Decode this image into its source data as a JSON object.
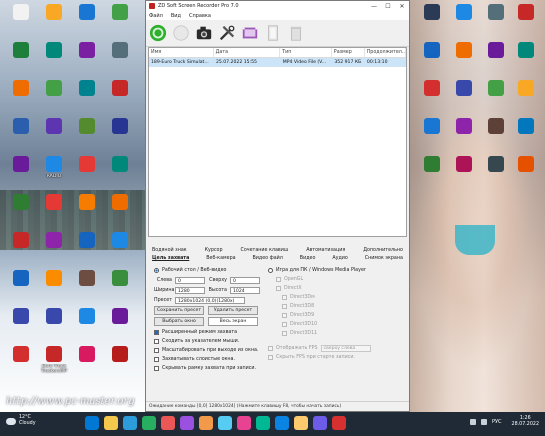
{
  "desktop": {
    "icons": [
      {
        "label": "",
        "color": "#f2f2f2"
      },
      {
        "label": "",
        "color": "#1e7f3c"
      },
      {
        "label": "",
        "color": "#ef6c00"
      },
      {
        "label": "",
        "color": "#2b5fae"
      },
      {
        "label": "",
        "color": "#6a1b9a"
      },
      {
        "label": "",
        "color": "#2e7d32"
      },
      {
        "label": "",
        "color": "#c62828"
      },
      {
        "label": "",
        "color": "#1565c0"
      },
      {
        "label": "",
        "color": "#3949ab"
      },
      {
        "label": "",
        "color": "#d32f2f"
      },
      {
        "label": "",
        "color": "#f9a825"
      },
      {
        "label": "",
        "color": "#00897b"
      },
      {
        "label": "",
        "color": "#43a047"
      },
      {
        "label": "",
        "color": "#5e35b1"
      },
      {
        "label": "RADIO",
        "color": "#1e88e5"
      },
      {
        "label": "",
        "color": "#e53935"
      },
      {
        "label": "",
        "color": "#8e24aa"
      },
      {
        "label": "",
        "color": "#fb8c00"
      },
      {
        "label": "",
        "color": "#3949ab"
      },
      {
        "label": "Euro Truck TruckersMP",
        "color": "#c62828"
      },
      {
        "label": "",
        "color": "#1976d2"
      },
      {
        "label": "",
        "color": "#7b1fa2"
      },
      {
        "label": "",
        "color": "#00838f"
      },
      {
        "label": "",
        "color": "#558b2f"
      },
      {
        "label": "",
        "color": "#e53935"
      },
      {
        "label": "",
        "color": "#f57c00"
      },
      {
        "label": "",
        "color": "#1565c0"
      },
      {
        "label": "",
        "color": "#6d4c41"
      },
      {
        "label": "",
        "color": "#1e88e5"
      },
      {
        "label": "",
        "color": "#d81b60"
      },
      {
        "label": "",
        "color": "#43a047"
      },
      {
        "label": "",
        "color": "#546e7a"
      },
      {
        "label": "",
        "color": "#c62828"
      },
      {
        "label": "",
        "color": "#283593"
      },
      {
        "label": "",
        "color": "#00897b"
      },
      {
        "label": "",
        "color": "#ef6c00"
      },
      {
        "label": "",
        "color": "#1e88e5"
      },
      {
        "label": "",
        "color": "#388e3c"
      },
      {
        "label": "",
        "color": "#6a1b9a"
      },
      {
        "label": "",
        "color": "#b71c1c"
      }
    ],
    "right_icons": [
      {
        "label": "",
        "color": "#2b3a55"
      },
      {
        "label": "",
        "color": "#1e88e5"
      },
      {
        "label": "",
        "color": "#546e7a"
      },
      {
        "label": "",
        "color": "#c62828"
      },
      {
        "label": "",
        "color": "#1565c0"
      },
      {
        "label": "",
        "color": "#ef6c00"
      },
      {
        "label": "",
        "color": "#6a1b9a"
      },
      {
        "label": "",
        "color": "#00897b"
      },
      {
        "label": "",
        "color": "#d32f2f"
      },
      {
        "label": "",
        "color": "#3949ab"
      },
      {
        "label": "",
        "color": "#43a047"
      },
      {
        "label": "",
        "color": "#f9a825"
      },
      {
        "label": "",
        "color": "#1976d2"
      },
      {
        "label": "",
        "color": "#8e24aa"
      },
      {
        "label": "",
        "color": "#5d4037"
      },
      {
        "label": "",
        "color": "#0277bd"
      },
      {
        "label": "",
        "color": "#2e7d32"
      },
      {
        "label": "",
        "color": "#ad1457"
      },
      {
        "label": "",
        "color": "#37474f"
      },
      {
        "label": "",
        "color": "#e65100"
      }
    ],
    "watermark": "http://www.pc-master.org"
  },
  "window": {
    "title": "ZD Soft Screen Recorder Pro 7.0",
    "controls": {
      "minimize": "—",
      "maximize": "☐",
      "close": "✕"
    },
    "menu": [
      "Файл",
      "Вид",
      "Справка"
    ]
  },
  "toolbar": {
    "icons": [
      "record-icon",
      "pause-icon",
      "screenshot-icon",
      "settings-icon",
      "video-icon",
      "file-icon",
      "delete-icon"
    ]
  },
  "filelist": {
    "columns": [
      "Имя",
      "Дата",
      "Тип",
      "Размер",
      "Продолжител..."
    ],
    "rows": [
      {
        "name": "189-Euro Truck Simulat...",
        "date": "25.07.2022 15:55",
        "type": "MP4 Video File (V...",
        "size": "352 917 КБ",
        "duration": "00:13:10"
      }
    ]
  },
  "tabs": {
    "row1": [
      "Водяной знак",
      "Курсор",
      "Сочетание клавиш",
      "Автоматизация",
      "Дополнительно"
    ],
    "row2": [
      "Цель захвата",
      "Веб-камера",
      "Видео файл",
      "Видео",
      "Аудио",
      "Снимок экрана"
    ],
    "active": "Цель захвата"
  },
  "capture": {
    "desktop_radio": "Рабочий стол / Веб-видео",
    "left_label": "Слева",
    "left_value": "0",
    "top_label": "Сверху",
    "top_value": "0",
    "width_label": "Ширина",
    "width_value": "1280",
    "height_label": "Высота",
    "height_value": "1024",
    "preset_label": "Пресет",
    "preset_value": "1280x1024 (0,0)(1280x(",
    "save_preset": "Сохранить пресет",
    "delete_preset": "Удалить пресет",
    "select_area": "Выбрать окно",
    "full_screen": "Весь экран",
    "checks": [
      {
        "label": "Расширенный режим захвата",
        "checked": true
      },
      {
        "label": "Сходить за указателем мыши.",
        "checked": false
      },
      {
        "label": "Масштабировать при выходе из окна.",
        "checked": false
      },
      {
        "label": "Захватывать слоистые окна.",
        "checked": false
      },
      {
        "label": "Скрывать рамку захвата при записи.",
        "checked": false
      }
    ],
    "game_radio": "Игра для ПК / Windows Media Player",
    "game_options": [
      "OpenGL",
      "DirectX",
      "Direct3Dм",
      "Direct3D8",
      "Direct3D9",
      "Direct3D10",
      "Direct3D11"
    ],
    "fps_label": "Отображать FPS",
    "fps_value": "сверху слева",
    "fps_hint": "Скрыть FPS при старте записи."
  },
  "status": {
    "text": "Ожидание команды [0,0] 1280x1024] (Нажмите клавишу F8, чтобы начать запись)"
  },
  "taskbar": {
    "weather_temp": "12°C",
    "weather_text": "Cloudy",
    "apps": [
      "#0078d4",
      "#f2c94c",
      "#2d9cdb",
      "#27ae60",
      "#eb5757",
      "#9b51e0",
      "#f2994a",
      "#56ccf2",
      "#e84393",
      "#00b894",
      "#0984e3",
      "#fdcb6e",
      "#6c5ce7",
      "#d63031"
    ],
    "lang": "РУС",
    "time": "1:26",
    "date": "28.07.2022"
  }
}
